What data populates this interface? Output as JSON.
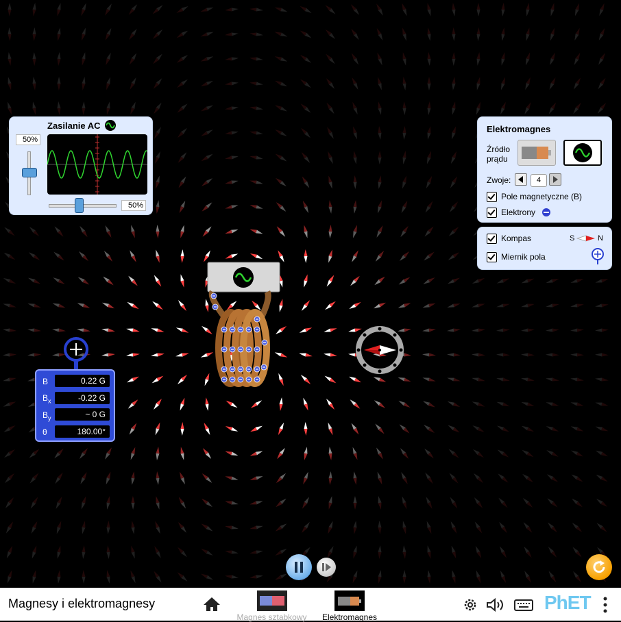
{
  "ac_panel": {
    "title": "Zasilanie AC",
    "amplitude_value": "50%",
    "frequency_value": "50%",
    "amplitude_level": 0.5,
    "frequency_level": 0.5
  },
  "electromagnet_panel": {
    "title": "Elektromagnes",
    "source_label_line1": "Źródło",
    "source_label_line2": "prądu",
    "turns_label": "Zwoje:",
    "turns_value": "4",
    "magnetic_field_label": "Pole magnetyczne (B)",
    "electrons_label": "Elektrony",
    "selected_source": "ac"
  },
  "options_panel": {
    "compass_label": "Kompas",
    "compass_s": "S",
    "compass_n": "N",
    "field_meter_label": "Miernik pola"
  },
  "field_meter": {
    "b_label": "B",
    "bx_label": "B",
    "bx_sub": "x",
    "by_label": "B",
    "by_sub": "y",
    "theta_label": "θ",
    "b_value": "0.22 G",
    "bx_value": "-0.22 G",
    "by_value": "~ 0 G",
    "theta_value": "180.00°"
  },
  "navbar": {
    "app_title": "Magnesy i elektromagnesy",
    "screen1_label": "Magnes sztabkowy",
    "screen2_label": "Elektromagnes",
    "active_screen": "Elektromagnes",
    "brand": "PhET"
  },
  "colors": {
    "panel_bg": "#e0ebff",
    "meter_bg": "#2f4bd6",
    "coil": "#b87333",
    "sine": "#2fd42f"
  }
}
